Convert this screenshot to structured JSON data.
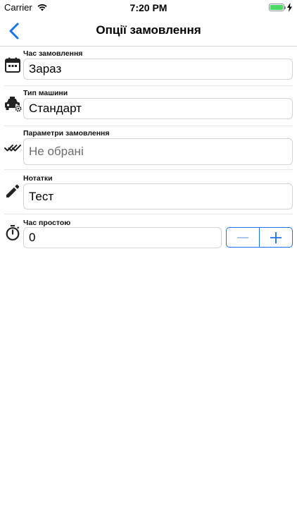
{
  "status_bar": {
    "carrier": "Carrier",
    "time": "7:20 PM",
    "battery_icon": "battery-charging-icon",
    "battery_color": "#4cd964"
  },
  "nav": {
    "title": "Опції замовлення",
    "back_icon": "chevron-left-icon",
    "accent_color": "#1a73e8"
  },
  "form": {
    "order_time": {
      "label": "Час замовлення",
      "value": "Зараз",
      "icon": "calendar-icon"
    },
    "car_type": {
      "label": "Тип машини",
      "value": "Стандарт",
      "icon": "taxi-settings-icon"
    },
    "order_params": {
      "label": "Параметри замовлення",
      "placeholder": "Не обрані",
      "icon": "double-check-icon"
    },
    "notes": {
      "label": "Нотатки",
      "value": "Тест",
      "icon": "pencil-icon"
    },
    "idle_time": {
      "label": "Час простою",
      "value": "0",
      "icon": "stopwatch-icon",
      "decrement_icon": "minus-icon",
      "increment_icon": "plus-icon"
    }
  }
}
